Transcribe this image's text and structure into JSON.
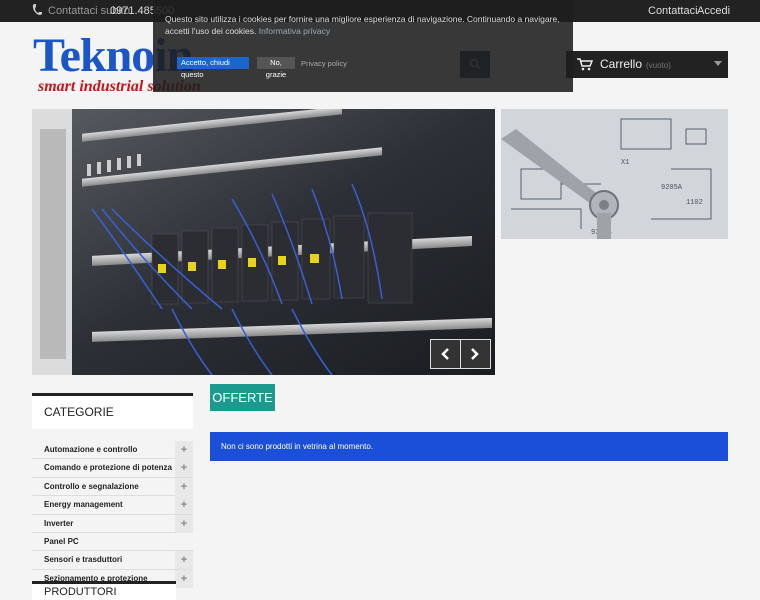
{
  "topbar": {
    "contact_label": "Contattaci subito",
    "phone": "0971.485500",
    "links": {
      "contattaci": "Contattaci",
      "accedi": "Accedi"
    }
  },
  "header": {
    "logo_title": "Teknoin",
    "logo_tagline": "smart industrial solution",
    "search_icon": "search-icon",
    "cart": {
      "label": "Carrello",
      "status": "(vuoto)"
    }
  },
  "cookie": {
    "text": "Questo sito utilizza i cookies per fornire una migliore esperienza di navigazione. Continuando a navigare, accetti l'uso dei cookies.",
    "privacy_link": "Informativa privacy",
    "accept_label": "Accetto, chiudi questo",
    "decline_label": "No, grazie",
    "policy_label": "Privacy policy"
  },
  "main": {
    "offerte_title": "OFFERTE",
    "notice": "Non ci sono prodotti in vetrina al momento."
  },
  "sidebar": {
    "categories_title": "CATEGORIE",
    "items": [
      {
        "label": "Automazione e controllo"
      },
      {
        "label": "Comando e protezione di potenza"
      },
      {
        "label": "Controllo e segnalazione"
      },
      {
        "label": "Energy management"
      },
      {
        "label": "Inverter"
      },
      {
        "label": "Panel PC"
      },
      {
        "label": "Sensori e trasduttori"
      },
      {
        "label": "Sezionamento e protezione"
      }
    ],
    "manufacturers_title": "PRODUTTORI"
  },
  "colors": {
    "logo_blue": "#1a56c8",
    "logo_red": "#c0181c",
    "offerte_teal": "#1a9b8d",
    "notice_blue": "#1b4fd8",
    "topbar": "#222222"
  }
}
